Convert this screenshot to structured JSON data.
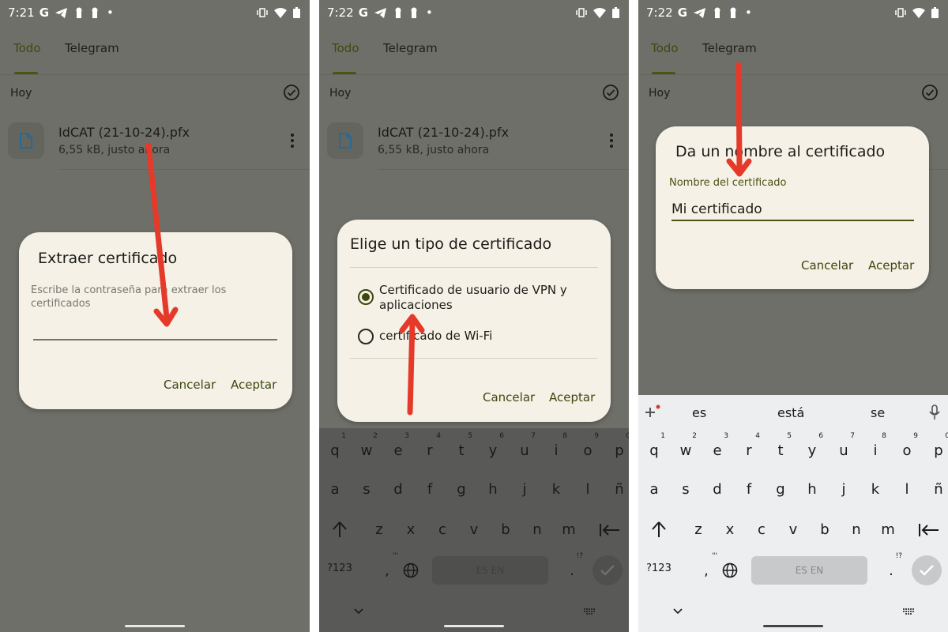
{
  "status": {
    "screen1_time": "7:21",
    "screen2_time": "7:22",
    "screen3_time": "7:22"
  },
  "tabs": {
    "todo": "Todo",
    "telegram": "Telegram"
  },
  "section_header": "Hoy",
  "file": {
    "name": "IdCAT (21-10-24).pfx",
    "meta": "6,55 kB, justo ahora"
  },
  "dialog1": {
    "title": "Extraer certificado",
    "subtitle": "Escribe la contraseña para extraer los certificados",
    "cancel_label": "Cancelar",
    "accept_label": "Aceptar"
  },
  "dialog2": {
    "title": "Elige un tipo de certificado",
    "options": [
      {
        "label": "Certificado de usuario de VPN y aplicaciones",
        "selected": true
      },
      {
        "label": "certificado de Wi-Fi",
        "selected": false
      }
    ],
    "cancel_label": "Cancelar",
    "accept_label": "Aceptar"
  },
  "dialog3": {
    "title": "Da un nombre al certificado",
    "field_label": "Nombre del certificado",
    "field_value": "Mi certificado",
    "cancel_label": "Cancelar",
    "accept_label": "Aceptar"
  },
  "keyboard": {
    "suggestions": [
      "es",
      "está",
      "se"
    ],
    "row1": [
      "q",
      "w",
      "e",
      "r",
      "t",
      "y",
      "u",
      "i",
      "o",
      "p"
    ],
    "row1_digits": [
      "1",
      "2",
      "3",
      "4",
      "5",
      "6",
      "7",
      "8",
      "9",
      "0"
    ],
    "row2": [
      "a",
      "s",
      "d",
      "f",
      "g",
      "h",
      "j",
      "k",
      "l",
      "ñ"
    ],
    "row3": [
      "z",
      "x",
      "c",
      "v",
      "b",
      "n",
      "m"
    ],
    "symbols_label": "?123",
    "comma_label": ",",
    "period_label": ".",
    "space_label": "ES EN",
    "punct_hint": "!?",
    "quote_hint": "\"'"
  },
  "colors": {
    "accent": "#4a5514",
    "dialog": "#f5f1e6",
    "scrim": "#6f6f69",
    "arrow": "#e53a2a"
  }
}
